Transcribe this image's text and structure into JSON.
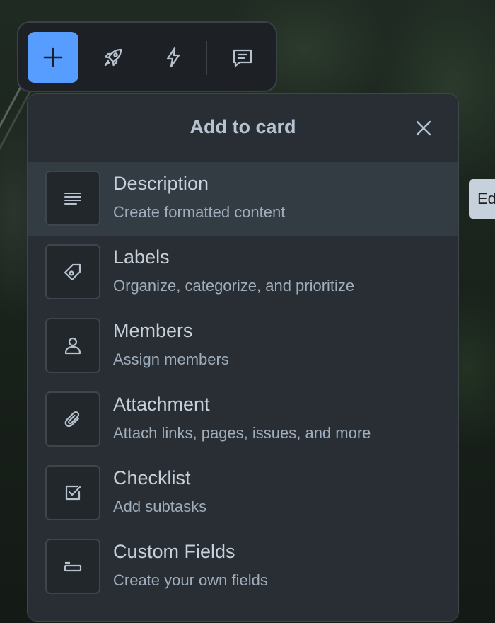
{
  "toolbar": {
    "buttons": [
      {
        "icon": "plus-icon",
        "active": true
      },
      {
        "icon": "rocket-icon"
      },
      {
        "icon": "bolt-icon"
      },
      {
        "icon": "comment-icon"
      }
    ],
    "accent_color": "#579dff"
  },
  "popover": {
    "title": "Add to card",
    "items": [
      {
        "title": "Description",
        "desc": "Create formatted content",
        "icon": "description-icon",
        "hovered": true
      },
      {
        "title": "Labels",
        "desc": "Organize, categorize, and prioritize",
        "icon": "tag-icon"
      },
      {
        "title": "Members",
        "desc": "Assign members",
        "icon": "person-icon"
      },
      {
        "title": "Attachment",
        "desc": "Attach links, pages, issues, and more",
        "icon": "paperclip-icon"
      },
      {
        "title": "Checklist",
        "desc": "Add subtasks",
        "icon": "checkbox-icon"
      },
      {
        "title": "Custom Fields",
        "desc": "Create your own fields",
        "icon": "custom-field-icon"
      }
    ]
  },
  "side_tab": {
    "label": "Ed"
  }
}
